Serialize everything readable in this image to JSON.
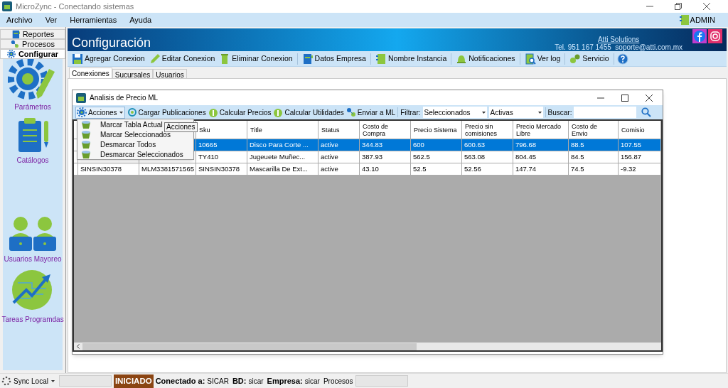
{
  "window": {
    "title": "MicroZync - Conectando sistemas"
  },
  "menu_bar": {
    "items": [
      "Archivo",
      "Ver",
      "Herramientas",
      "Ayuda"
    ],
    "user": "ADMIN"
  },
  "sidebar": {
    "tabs": [
      {
        "label": "Reportes",
        "selected": false
      },
      {
        "label": "Procesos",
        "selected": false
      },
      {
        "label": "Configurar",
        "selected": true
      }
    ],
    "items": [
      "Parámetros",
      "Catálogos",
      "Usuarios Mayoreo",
      "Tareas Programdas"
    ]
  },
  "header": {
    "title": "Configuración",
    "company": "Atti Solutions",
    "contact": "Tel. 951 167 1455  soporte@atti.com.mx"
  },
  "toolbar": [
    "Agregar Conexion",
    "Editar Conexion",
    "Eliminar Conexion",
    "Datos Empresa",
    "Nombre Instancia",
    "Notificaciones",
    "Ver log",
    "Servicio"
  ],
  "tabs": [
    {
      "label": "Conexiones",
      "selected": true
    },
    {
      "label": "Sucursales",
      "selected": false
    },
    {
      "label": "Usuarios",
      "selected": false
    }
  ],
  "child_window": {
    "title": "Analisis de Precio ML",
    "toolbar": {
      "actions": "Acciones",
      "buttons": [
        "Cargar Publicaciones",
        "Calcular Precios",
        "Calcular Utilidades",
        "Enviar a ML"
      ],
      "filter_label": "Filtrar:",
      "filter_1": "Seleccionados",
      "filter_2": "Activas",
      "search_label": "Buscar:"
    },
    "actions_menu": [
      "Marcar Tabla Actual",
      "Marcar Seleccionados",
      "Desmarcar Todos",
      "Desmarcar Seleccionados"
    ],
    "tooltip": "Acciones",
    "table": {
      "columns": [
        "Sku",
        "Title",
        "Status",
        "Costo de Compra",
        "Precio Sistema",
        "Precio sin comisiones",
        "Precio Mercado Libre",
        "Costo de Envio",
        "Comisio"
      ],
      "rows": [
        {
          "selected": true,
          "cells": [
            "10665",
            "Disco Para Corte ...",
            "active",
            "344.83",
            "600",
            "600.63",
            "796.68",
            "88.5",
            "107.55"
          ]
        },
        {
          "selected": false,
          "cells": [
            "TY410",
            "Jugeuete Muñec...",
            "active",
            "387.93",
            "562.5",
            "563.08",
            "804.45",
            "84.5",
            "156.87"
          ]
        },
        {
          "selected": false,
          "leading_cells": [
            "SINSIN30378",
            "MLM3381571565"
          ],
          "cells": [
            "SINSIN30378",
            "Mascarilla De Ext...",
            "active",
            "43.10",
            "52.5",
            "52.56",
            "147.74",
            "74.5",
            "-9.32"
          ]
        }
      ]
    }
  },
  "status_bar": {
    "sync": "Sync Local",
    "state": "INICIADO",
    "connected_label": "Conectado a:",
    "connected": "SICAR",
    "db_label": "BD:",
    "db": "sicar",
    "company_label": "Empresa:",
    "company": "sicar",
    "processes": "Procesos"
  }
}
